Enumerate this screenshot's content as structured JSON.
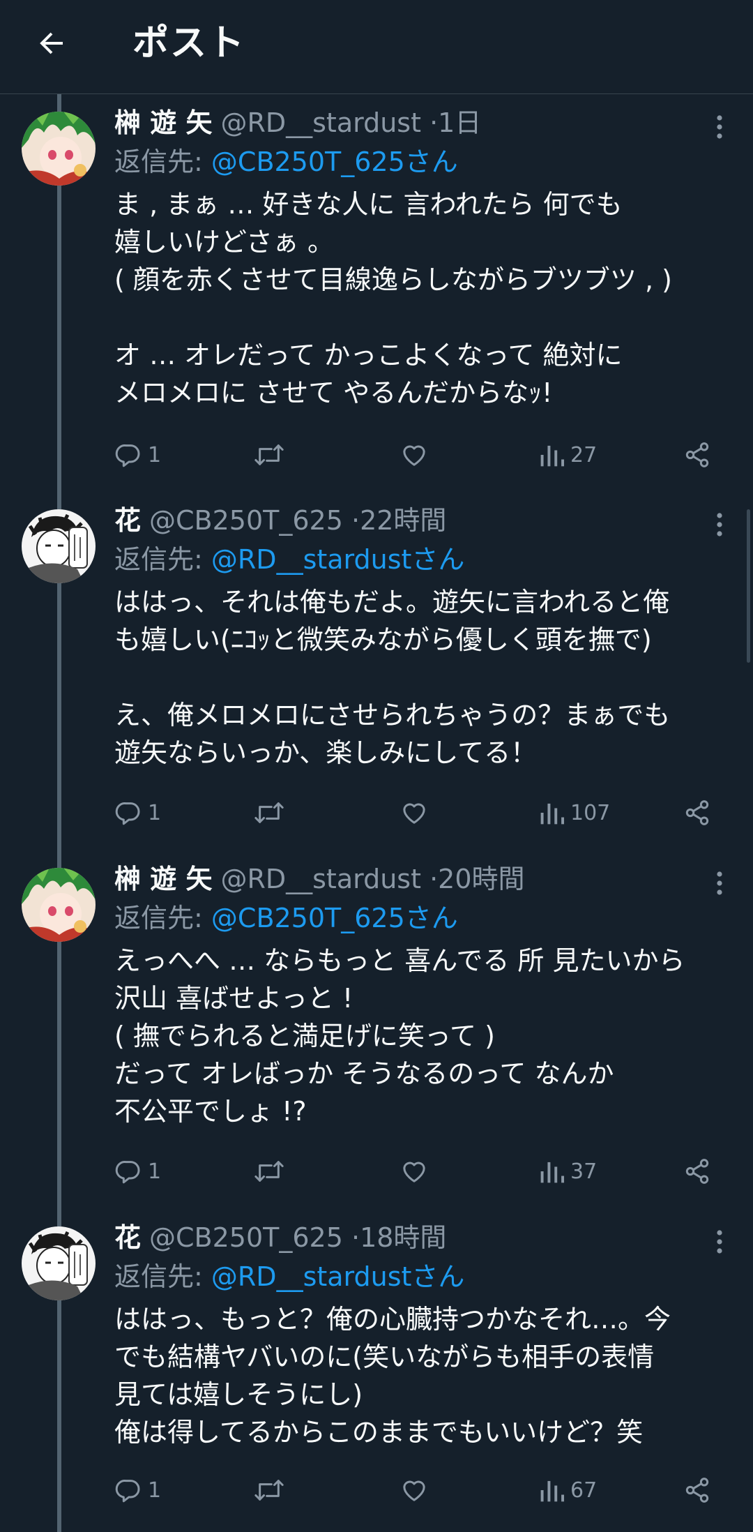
{
  "header": {
    "title": "ポスト"
  },
  "colors": {
    "background": "#15202b",
    "link": "#1d9bf0",
    "muted": "#8b98a5",
    "thread_line": "#536471"
  },
  "icons": {
    "back": "arrow-left-icon",
    "more": "more-vertical-icon",
    "reply": "reply-icon",
    "retweet": "retweet-icon",
    "like": "heart-icon",
    "views": "views-icon",
    "share": "share-icon"
  },
  "posts": [
    {
      "name": "榊 遊 矢",
      "handle": "@RD__stardust",
      "dot": "·",
      "time": "1日",
      "reply_label": "返信先:",
      "reply_to": "@CB250T_625さん",
      "text": "ま , まぁ … 好きな人に 言われたら 何でも\n嬉しいけどさぁ 。\n( 顔を赤くさせて目線逸らしながらブツブツ , )\n\nオ … オレだって かっこよくなって 絶対に\nメロメロに させて やるんだからなｯ!",
      "replies": "1",
      "views": "27"
    },
    {
      "name": "花",
      "handle": "@CB250T_625",
      "dot": "·",
      "time": "22時間",
      "reply_label": "返信先:",
      "reply_to": "@RD__stardustさん",
      "text": "ははっ、それは俺もだよ。遊矢に言われると俺\nも嬉しい(ﾆｺｯと微笑みながら優しく頭を撫で)\n\nえ、俺メロメロにさせられちゃうの？まぁでも\n遊矢ならいっか、楽しみにしてる！",
      "replies": "1",
      "views": "107"
    },
    {
      "name": "榊 遊 矢",
      "handle": "@RD__stardust",
      "dot": "·",
      "time": "20時間",
      "reply_label": "返信先:",
      "reply_to": "@CB250T_625さん",
      "text": "えっへへ … ならもっと 喜んでる 所 見たいから\n沢山 喜ばせよっと !\n( 撫でられると満足げに笑って )\nだって オレばっか そうなるのって なんか\n不公平でしょ !?",
      "replies": "1",
      "views": "37"
    },
    {
      "name": "花",
      "handle": "@CB250T_625",
      "dot": "·",
      "time": "18時間",
      "reply_label": "返信先:",
      "reply_to": "@RD__stardustさん",
      "text": "ははっ、もっと？俺の心臓持つかなそれ…。今\nでも結構ヤバいのに(笑いながらも相手の表情\n見ては嬉しそうにし)\n俺は得してるからこのままでもいいけど？笑",
      "replies": "1",
      "views": "67"
    }
  ]
}
